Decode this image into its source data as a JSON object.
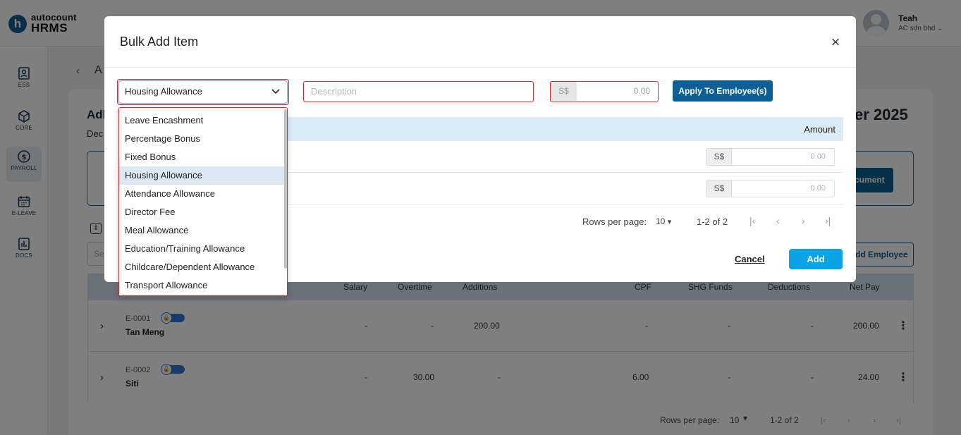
{
  "app": {
    "logo_top": "autocount",
    "logo_bottom": "HRMS",
    "logo_mark": "h",
    "user_name": "Teah",
    "user_company": "AC sdn bhd ⌄"
  },
  "sidebar": {
    "items": [
      {
        "label": "ESS",
        "icon": "ess-icon"
      },
      {
        "label": "CORE",
        "icon": "core-icon"
      },
      {
        "label": "PAYROLL",
        "icon": "payroll-icon",
        "active": true
      },
      {
        "label": "E-LEAVE",
        "icon": "calendar-icon"
      },
      {
        "label": "DOCS",
        "icon": "docs-icon"
      }
    ]
  },
  "background_page": {
    "breadcrumb": "A",
    "title_left": "Adl",
    "subtitle_left": "Dec",
    "title_right": "er 2025",
    "document_button": "cument",
    "search_placeholder": "Se",
    "add_employee_button": "dd Employee",
    "table_headers": [
      "Salary",
      "Overtime",
      "Additions",
      "CPF",
      "SHG Funds",
      "Deductions",
      "Net Pay"
    ],
    "rows": [
      {
        "code": "E-0001",
        "name": "Tan Meng",
        "salary": "-",
        "overtime": "-",
        "additions": "200.00",
        "cpf": "-",
        "shg": "-",
        "deductions": "-",
        "net_pay": "200.00"
      },
      {
        "code": "E-0002",
        "name": "Siti",
        "salary": "-",
        "overtime": "30.00",
        "additions": "-",
        "cpf": "6.00",
        "shg": "-",
        "deductions": "-",
        "net_pay": "24.00"
      }
    ],
    "pager": {
      "label": "Rows per page:",
      "size": "10",
      "range": "1-2 of 2"
    }
  },
  "modal": {
    "title": "Bulk Add Item",
    "item_select_value": "Housing Allowance",
    "description_placeholder": "Description",
    "amount_prefix": "S$",
    "amount_value": "0.00",
    "apply_button": "Apply To Employee(s)",
    "amount_header": "Amount",
    "rows": [
      {
        "prefix": "S$",
        "value": "0.00"
      },
      {
        "prefix": "S$",
        "value": "0.00"
      }
    ],
    "pager": {
      "label": "Rows per page:",
      "size": "10",
      "range": "1-2 of 2"
    },
    "cancel_button": "Cancel",
    "add_button": "Add"
  },
  "dropdown": {
    "options": [
      "Leave Encashment",
      "Percentage Bonus",
      "Fixed Bonus",
      "Housing Allowance",
      "Attendance Allowance",
      "Director Fee",
      "Meal Allowance",
      "Education/Training Allowance",
      "Childcare/Dependent Allowance",
      "Transport Allowance"
    ],
    "selected": "Housing Allowance"
  },
  "colors": {
    "brand": "#0d5f95",
    "primary_action": "#0aa3e6",
    "error_frame": "#e0242a",
    "selected_option": "#dde8f5"
  }
}
